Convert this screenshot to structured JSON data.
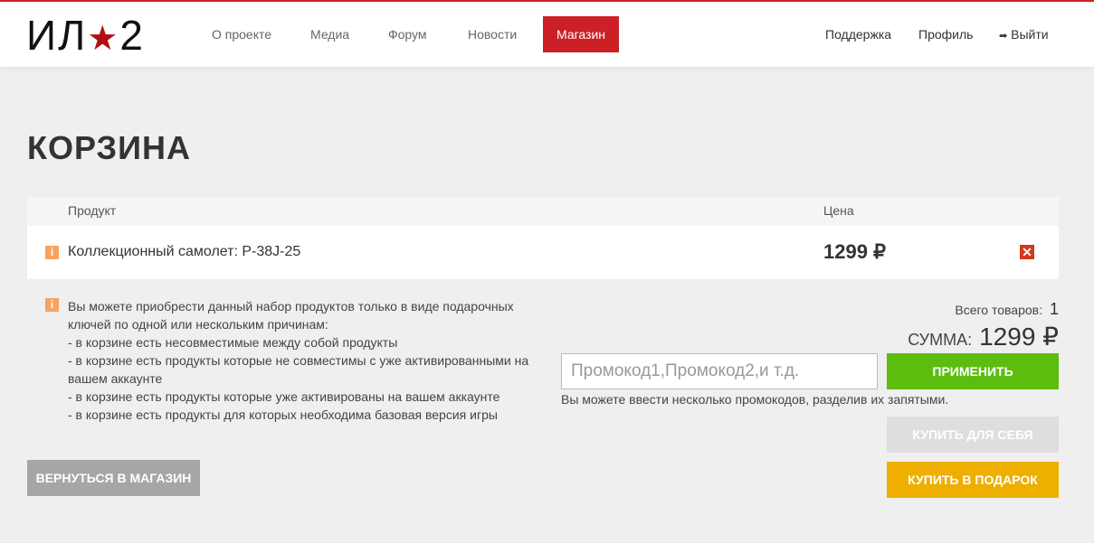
{
  "header": {
    "logo": "ИЛ★2",
    "nav": [
      "О проекте",
      "Медиа",
      "Форум",
      "Новости",
      "Магазин"
    ],
    "support": "Поддержка",
    "profile": "Профиль",
    "logout": "Выйти"
  },
  "page_title": "КОРЗИНА",
  "table": {
    "col_product": "Продукт",
    "col_price": "Цена",
    "items": [
      {
        "name": "Коллекционный самолет: P-38J-25",
        "price": "1299 ₽"
      }
    ]
  },
  "note": [
    "Вы можете приобрести данный набор продуктов только в виде подарочных ключей по одной или нескольким причинам:",
    "- в корзине есть несовместимые между собой продукты",
    "- в корзине есть продукты которые не совместимы с уже активированными на вашем аккаунте",
    "- в корзине есть продукты которые уже активированы на вашем аккаунте",
    "- в корзине есть продукты для которых необходима базовая версия игры"
  ],
  "back_button": "ВЕРНУТЬСЯ В МАГАЗИН",
  "summary": {
    "total_label": "Всего товаров:",
    "total_value": "1",
    "sum_label": "СУММА:",
    "sum_value": "1299 ₽"
  },
  "promo": {
    "placeholder": "Промокод1,Промокод2,и т.д.",
    "value": "",
    "apply": "ПРИМЕНИТЬ",
    "hint": "Вы можете ввести несколько промокодов, разделив их запятыми."
  },
  "buy_self": "КУПИТЬ ДЛЯ СЕБЯ",
  "buy_gift": "КУПИТЬ В ПОДАРОК"
}
